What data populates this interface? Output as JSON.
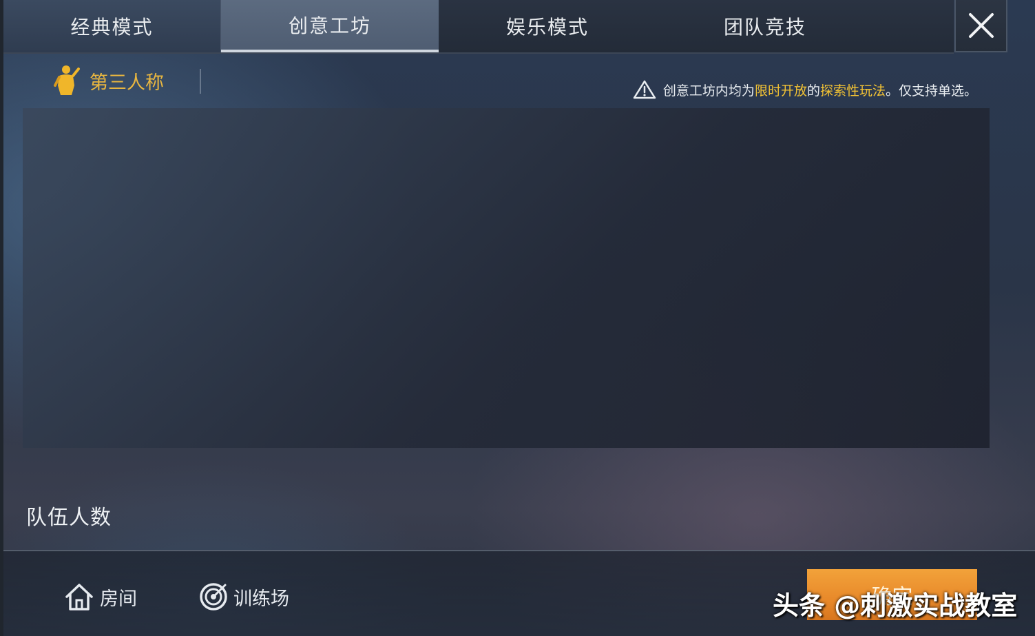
{
  "tabs": [
    {
      "label": "经典模式"
    },
    {
      "label": "创意工坊"
    },
    {
      "label": "娱乐模式"
    },
    {
      "label": "团队竞技"
    }
  ],
  "active_tab": "创意工坊",
  "perspective": {
    "label": "第三人称",
    "icon": "character-icon"
  },
  "notice": {
    "p1": "创意工坊内均为",
    "p2": "限时开放",
    "p3": "的",
    "p4": "探索性玩法",
    "p5": "。仅支持单选。"
  },
  "team_size": {
    "label": "队伍人数"
  },
  "bottom_nav": {
    "room": "房间",
    "training": "训练场"
  },
  "confirm": {
    "label": "确定"
  },
  "watermark": {
    "text": "头条 @刺激实战教室"
  },
  "colors": {
    "accent_gold": "#f2c234",
    "confirm_orange": "#e8892a"
  }
}
